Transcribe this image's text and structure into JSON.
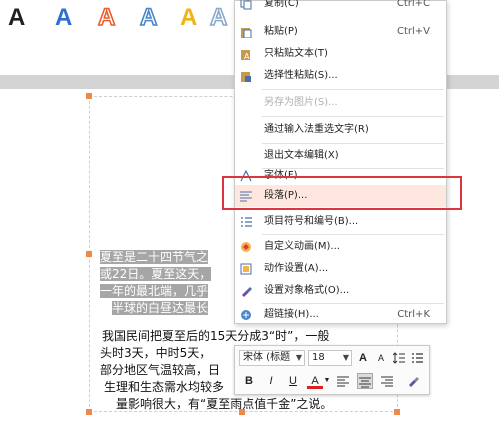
{
  "wordart": {
    "presets": [
      {
        "label": "A",
        "style": "black-fill"
      },
      {
        "label": "A",
        "style": "blue-fill"
      },
      {
        "label": "A",
        "style": "orange-outline"
      },
      {
        "label": "A",
        "style": "blue-outline"
      },
      {
        "label": "A",
        "style": "gold-fill"
      },
      {
        "label": "A",
        "style": "light-outline"
      }
    ]
  },
  "document": {
    "para1_lines": [
      "夏至是二十四节气之",
      "或22日。夏至这天，",
      "一年的最北端，几乎",
      "半球的白昼达最长"
    ],
    "para2_lines": [
      "我国民间把夏至后的15天分成3“时”，一般",
      "头时3天，中时5天，",
      "部分地区气温较高，日",
      "生理和生态需水均较多",
      "量影响很大，有“夏至雨点值千金”之说。"
    ]
  },
  "context_menu": {
    "items": [
      {
        "label": "复制(C)",
        "shortcut": "Ctrl+C",
        "icon": "copy-icon",
        "enabled": true
      },
      {
        "label": "粘贴(P)",
        "shortcut": "Ctrl+V",
        "icon": "paste-icon",
        "enabled": true
      },
      {
        "label": "只粘贴文本(T)",
        "shortcut": "",
        "icon": "paste-text-icon",
        "enabled": true
      },
      {
        "label": "选择性粘贴(S)...",
        "shortcut": "",
        "icon": "paste-special-icon",
        "enabled": true
      },
      {
        "label": "另存为图片(S)...",
        "shortcut": "",
        "icon": "",
        "enabled": false
      },
      {
        "label": "通过输入法重选文字(R)",
        "shortcut": "",
        "icon": "",
        "enabled": true
      },
      {
        "label": "退出文本编辑(X)",
        "shortcut": "",
        "icon": "",
        "enabled": true
      },
      {
        "label": "字体(F)...",
        "shortcut": "",
        "icon": "font-icon",
        "enabled": true
      },
      {
        "label": "段落(P)...",
        "shortcut": "",
        "icon": "paragraph-icon",
        "enabled": true
      },
      {
        "label": "项目符号和编号(B)...",
        "shortcut": "",
        "icon": "bullets-icon",
        "enabled": true
      },
      {
        "label": "自定义动画(M)...",
        "shortcut": "",
        "icon": "animation-icon",
        "enabled": true
      },
      {
        "label": "动作设置(A)...",
        "shortcut": "",
        "icon": "action-icon",
        "enabled": true
      },
      {
        "label": "设置对象格式(O)...",
        "shortcut": "",
        "icon": "format-object-icon",
        "enabled": true
      },
      {
        "label": "超链接(H)...",
        "shortcut": "Ctrl+K",
        "icon": "hyperlink-icon",
        "enabled": true
      }
    ]
  },
  "mini_toolbar": {
    "font_name": "宋体 (标题",
    "font_size": "18",
    "grow_label": "A",
    "shrink_label": "A",
    "bold_label": "B",
    "italic_label": "I",
    "underline_label": "U",
    "font_color_label": "A",
    "font_color": "#e02020"
  },
  "colors": {
    "highlight_box": "#d9363e",
    "selected_menu_bg": "#fde7df",
    "handle": "#f0884b"
  }
}
